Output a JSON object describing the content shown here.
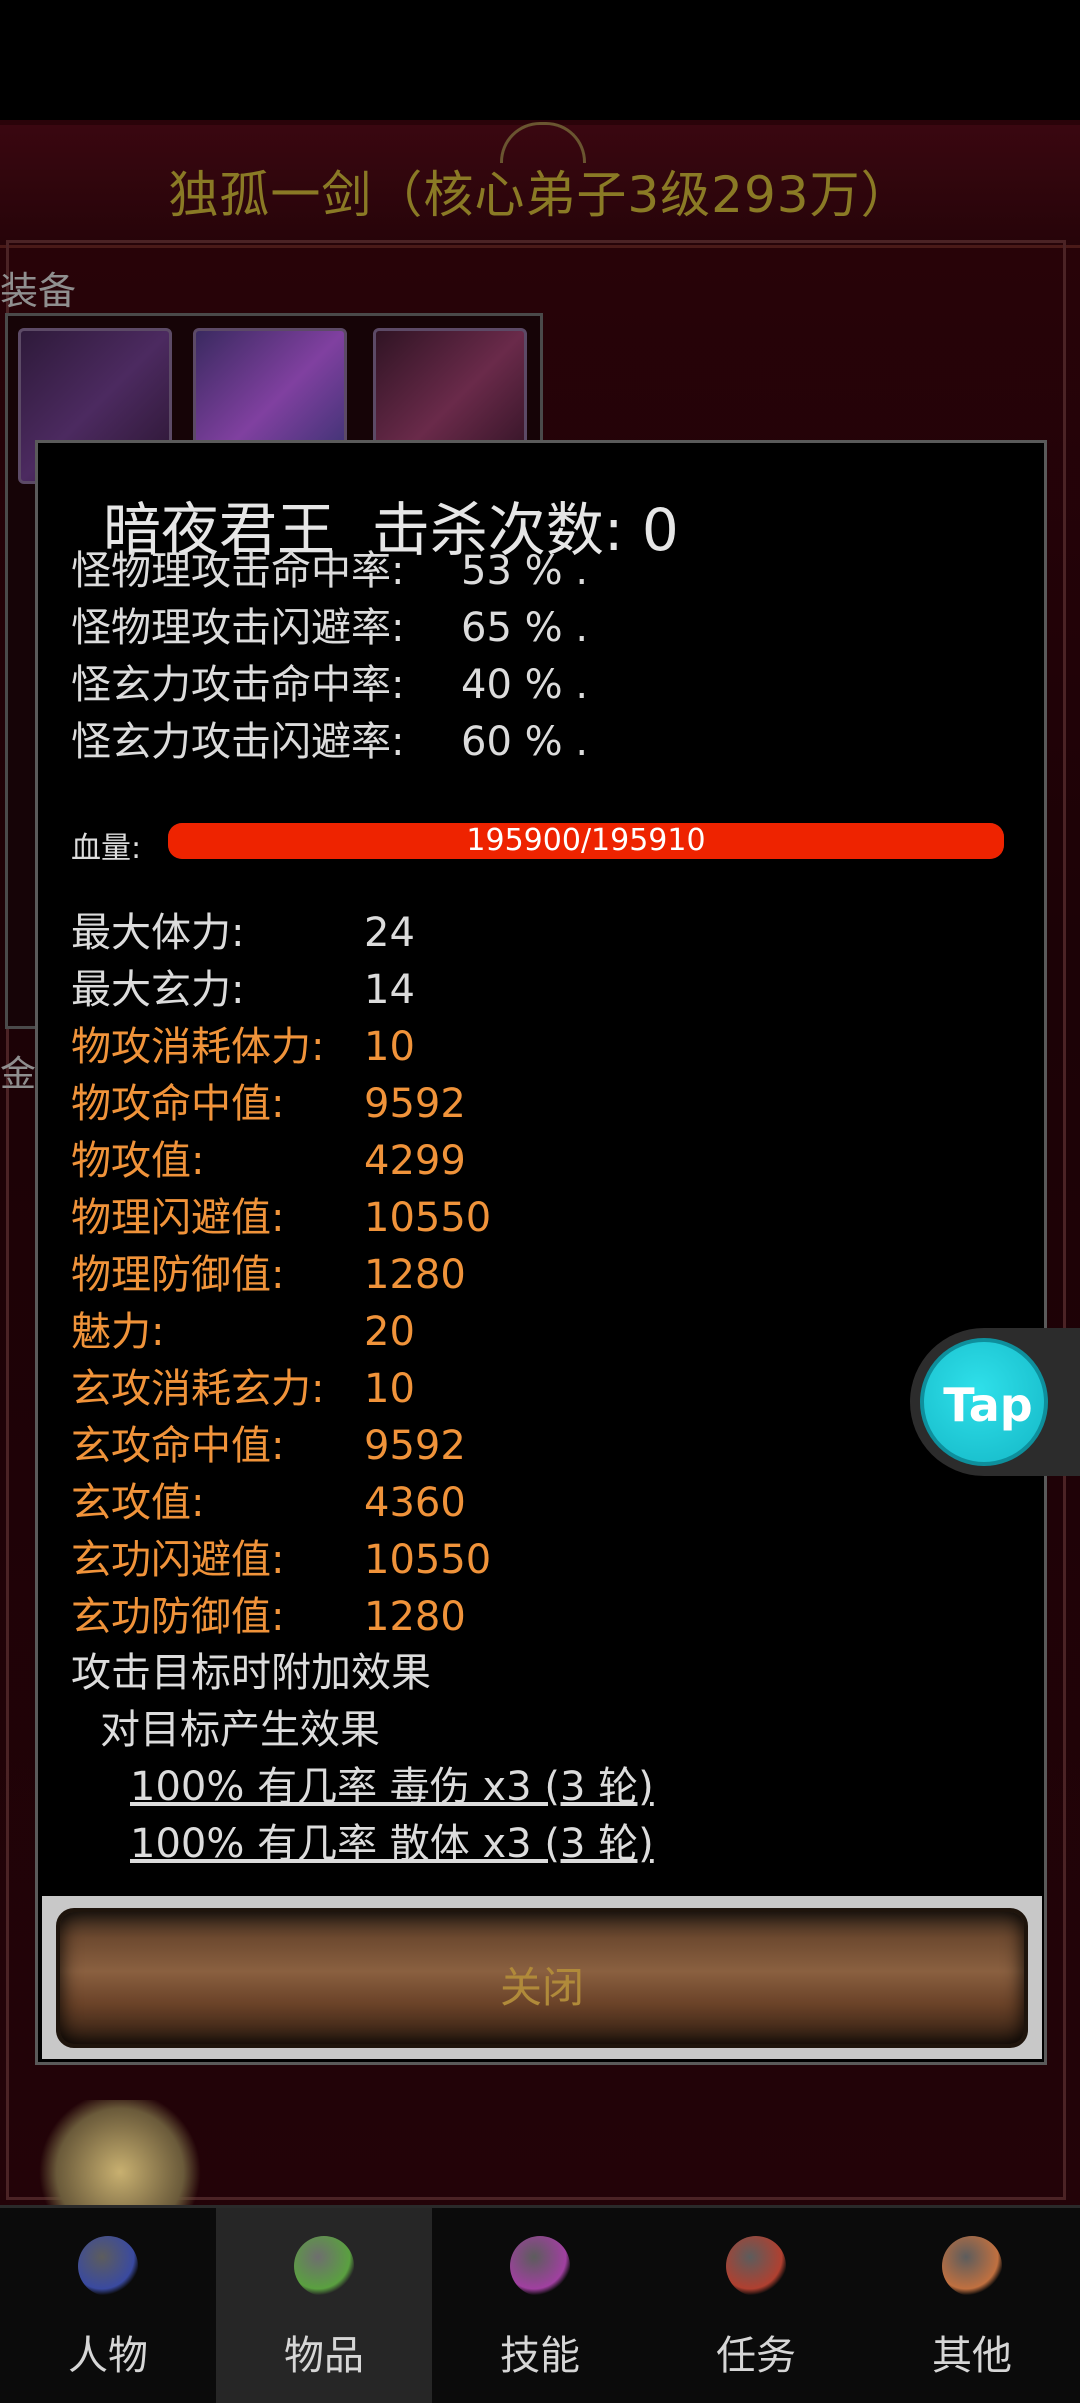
{
  "background": {
    "title": "独孤一剑（核心弟子3级293万）",
    "equip_label": "装备",
    "gold_label": "金币"
  },
  "modal": {
    "monster_name": "暗夜君王",
    "kills_label": "击杀次数:",
    "kills_value": "0",
    "rates": [
      {
        "label": "怪物理攻击命中率:",
        "value": "53 % ."
      },
      {
        "label": "怪物理攻击闪避率:",
        "value": "65 % ."
      },
      {
        "label": "怪玄力攻击命中率:",
        "value": "40 % ."
      },
      {
        "label": "怪玄力攻击闪避率:",
        "value": "60 % ."
      }
    ],
    "hp": {
      "label": "血量:",
      "text": "195900/195910",
      "current": 195900,
      "max": 195910,
      "color": "#ee2300"
    },
    "stats": [
      {
        "label": "最大体力:",
        "value": "24",
        "style": "white"
      },
      {
        "label": "最大玄力:",
        "value": "14",
        "style": "white"
      },
      {
        "label": "物攻消耗体力:",
        "value": "10",
        "style": "orange"
      },
      {
        "label": "物攻命中值:",
        "value": "9592",
        "style": "orange"
      },
      {
        "label": "物攻值:",
        "value": "4299",
        "style": "orange"
      },
      {
        "label": "物理闪避值:",
        "value": "10550",
        "style": "orange"
      },
      {
        "label": "物理防御值:",
        "value": "1280",
        "style": "orange"
      },
      {
        "label": "魅力:",
        "value": "20",
        "style": "orange"
      },
      {
        "label": "玄攻消耗玄力:",
        "value": "10",
        "style": "orange"
      },
      {
        "label": "玄攻命中值:",
        "value": "9592",
        "style": "orange"
      },
      {
        "label": "玄攻值:",
        "value": "4360",
        "style": "orange"
      },
      {
        "label": "玄功闪避值:",
        "value": "10550",
        "style": "orange"
      },
      {
        "label": "玄功防御值:",
        "value": "1280",
        "style": "orange"
      }
    ],
    "effects_heading": "攻击目标时附加效果",
    "effects_sub": "对目标产生效果",
    "effects": [
      "100% 有几率 毒伤 x3 (3 轮)",
      "100% 有几率 散体 x3 (3 轮)"
    ],
    "close_label": "关闭"
  },
  "tap_badge": "Tap",
  "nav": [
    {
      "label": "人物",
      "icon": "character-icon",
      "active": false,
      "color": "#3a4aa0"
    },
    {
      "label": "物品",
      "icon": "potion-icon",
      "active": true,
      "color": "#5aa040"
    },
    {
      "label": "技能",
      "icon": "skill-orb-icon",
      "active": false,
      "color": "#a040a0"
    },
    {
      "label": "任务",
      "icon": "quest-icon",
      "active": false,
      "color": "#b04030"
    },
    {
      "label": "其他",
      "icon": "tools-icon",
      "active": false,
      "color": "#c07040"
    }
  ],
  "colors": {
    "orange_stat": "#f0933a",
    "white_stat": "#dcdcdc",
    "hp_bar": "#ee2300",
    "tap": "#14b7c6"
  }
}
